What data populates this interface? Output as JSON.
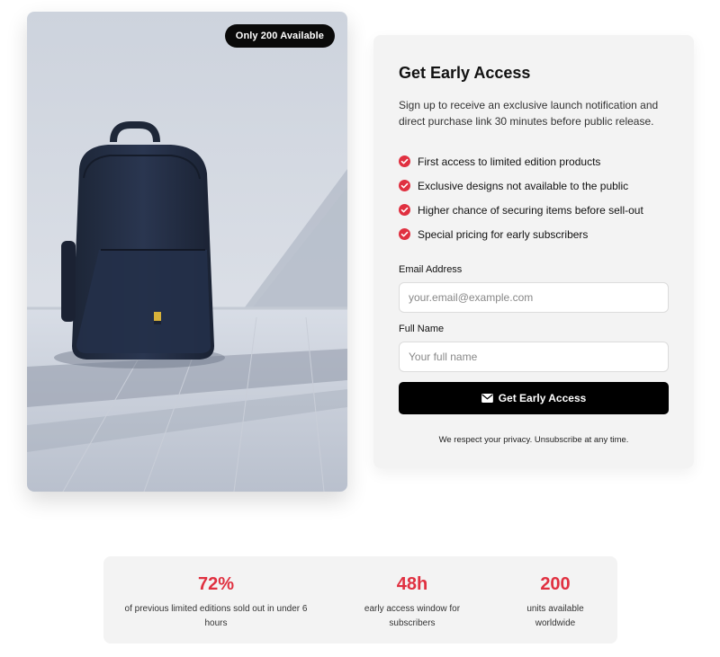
{
  "product": {
    "badge": "Only 200 Available",
    "image": "blue backpack on light floor"
  },
  "signup": {
    "title": "Get Early Access",
    "description": "Sign up to receive an exclusive launch notification and direct purchase link 30 minutes before public release.",
    "benefits": [
      {
        "label": "First access to limited edition products"
      },
      {
        "label": "Exclusive designs not available to the public"
      },
      {
        "label": "Higher chance of securing items before sell-out"
      },
      {
        "label": "Special pricing for early subscribers"
      }
    ],
    "email": {
      "label": "Email Address",
      "placeholder": "your.email@example.com",
      "value": ""
    },
    "name": {
      "label": "Full Name",
      "placeholder": "Your full name",
      "value": ""
    },
    "cta_label": "Get Early Access",
    "cta_icon": "envelope-icon",
    "privacy": "We respect your privacy. Unsubscribe at any time."
  },
  "stats": [
    {
      "value": "72%",
      "label": "of previous limited editions sold out in under 6 hours"
    },
    {
      "value": "48h",
      "label": "early access window for subscribers"
    },
    {
      "value": "200",
      "label": "units available worldwide"
    }
  ],
  "colors": {
    "accent": "#e03040",
    "button": "#000000",
    "panel": "#f3f3f3"
  }
}
